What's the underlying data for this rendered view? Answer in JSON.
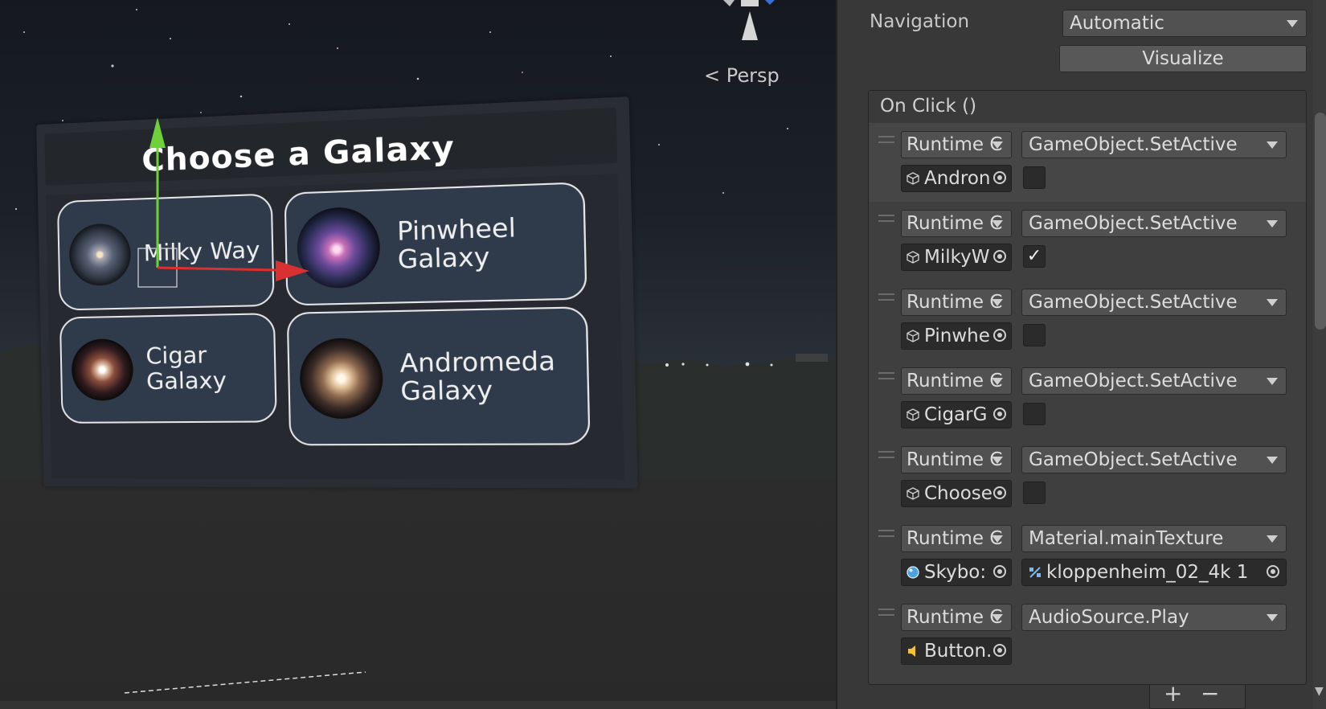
{
  "scene": {
    "view_mode": "Persp",
    "panel": {
      "title": "Choose a Galaxy",
      "buttons": [
        {
          "label": "Milky Way",
          "thumb": "milky-way-image"
        },
        {
          "label": "Pinwheel\nGalaxy",
          "thumb": "pinwheel-galaxy-image"
        },
        {
          "label": "Cigar Galaxy",
          "thumb": "cigar-galaxy-image"
        },
        {
          "label": "Andromeda\nGalaxy",
          "thumb": "andromeda-galaxy-image"
        }
      ]
    }
  },
  "inspector": {
    "navigation_label": "Navigation",
    "navigation_value": "Automatic",
    "visualize_label": "Visualize",
    "onclick": {
      "title": "On Click ()",
      "entries": [
        {
          "runtime": "Runtime C",
          "func": "GameObject.SetActive",
          "target": "Andron",
          "target_icon": "cube-icon",
          "checked": false,
          "checkmark": ""
        },
        {
          "runtime": "Runtime C",
          "func": "GameObject.SetActive",
          "target": "MilkyW",
          "target_icon": "cube-icon",
          "checked": true,
          "checkmark": "✓"
        },
        {
          "runtime": "Runtime C",
          "func": "GameObject.SetActive",
          "target": "Pinwhe",
          "target_icon": "cube-icon",
          "checked": false,
          "checkmark": ""
        },
        {
          "runtime": "Runtime C",
          "func": "GameObject.SetActive",
          "target": "CigarG",
          "target_icon": "cube-icon",
          "checked": false,
          "checkmark": ""
        },
        {
          "runtime": "Runtime C",
          "func": "GameObject.SetActive",
          "target": "Choose",
          "target_icon": "cube-icon",
          "checked": false,
          "checkmark": ""
        },
        {
          "runtime": "Runtime C",
          "func": "Material.mainTexture",
          "target": "Skybo:",
          "target_icon": "material-sphere-icon",
          "arg": "kloppenheim_02_4k 1",
          "arg_icon": "texture-icon"
        },
        {
          "runtime": "Runtime C",
          "func": "AudioSource.Play",
          "target": "Button.",
          "target_icon": "speaker-icon"
        }
      ]
    },
    "footer": {
      "plus": "+",
      "minus": "−"
    }
  },
  "colors": {
    "inspector_bg": "#383838",
    "button_fill": "#2f3a4b",
    "axis_y": "#6fd13a",
    "axis_x": "#d93131"
  }
}
